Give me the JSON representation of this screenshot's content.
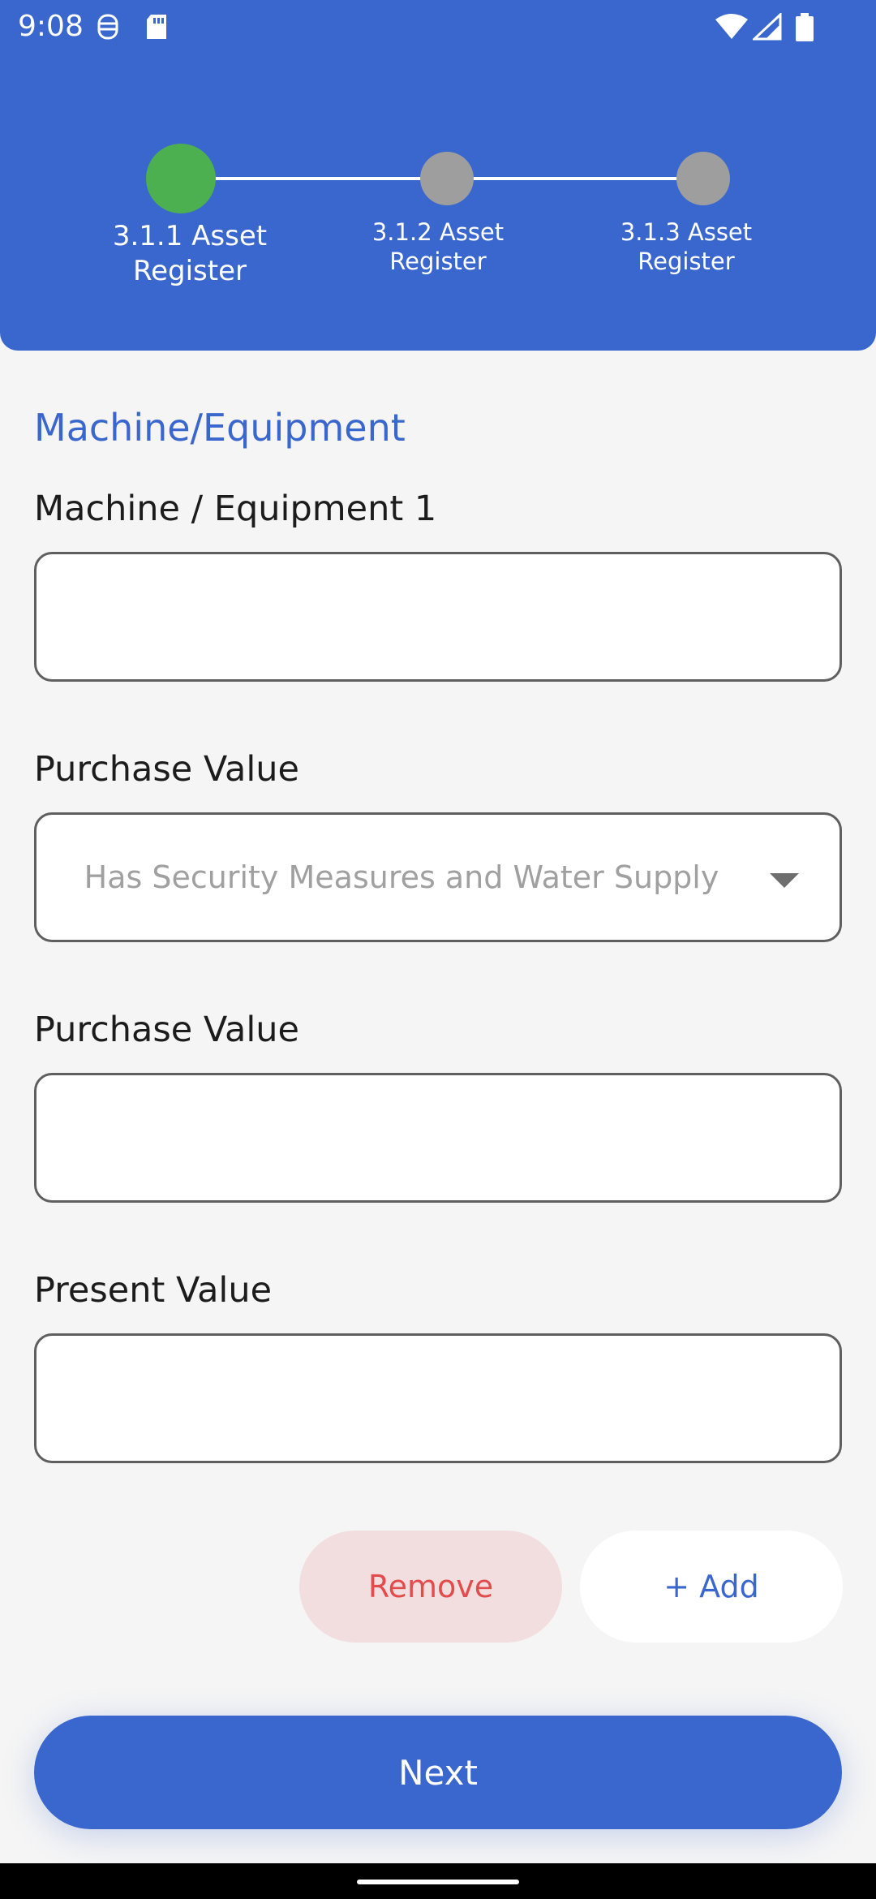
{
  "status_bar": {
    "time": "9:08",
    "left_icons": [
      "bug-icon",
      "sd-card-icon"
    ],
    "right_icons": [
      "wifi-icon",
      "signal-icon",
      "battery-icon"
    ]
  },
  "stepper": {
    "steps": [
      {
        "label": "3.1.1 Asset Register",
        "line1": "3.1.1 Asset",
        "line2": "Register",
        "state": "active",
        "color": "#4caf50"
      },
      {
        "label": "3.1.2 Asset Register",
        "line1": "3.1.2 Asset",
        "line2": "Register",
        "state": "inactive",
        "color": "#9e9e9e"
      },
      {
        "label": "3.1.3 Asset Register",
        "line1": "3.1.3 Asset",
        "line2": "Register",
        "state": "inactive",
        "color": "#9e9e9e"
      }
    ]
  },
  "form": {
    "section_title": "Machine/Equipment",
    "fields": [
      {
        "label": "Machine / Equipment 1",
        "type": "text",
        "value": ""
      },
      {
        "label": "Purchase Value",
        "type": "dropdown",
        "placeholder": "Has Security Measures and Water Supply"
      },
      {
        "label": "Purchase Value",
        "type": "text",
        "value": ""
      },
      {
        "label": "Present Value",
        "type": "text",
        "value": ""
      }
    ]
  },
  "actions": {
    "remove_label": "Remove",
    "add_label": "+ Add",
    "next_label": "Next"
  },
  "colors": {
    "primary": "#3a67ce",
    "active_step": "#4caf50",
    "inactive_step": "#9e9e9e",
    "remove_bg": "#f2dede",
    "remove_text": "#e24c4c"
  }
}
